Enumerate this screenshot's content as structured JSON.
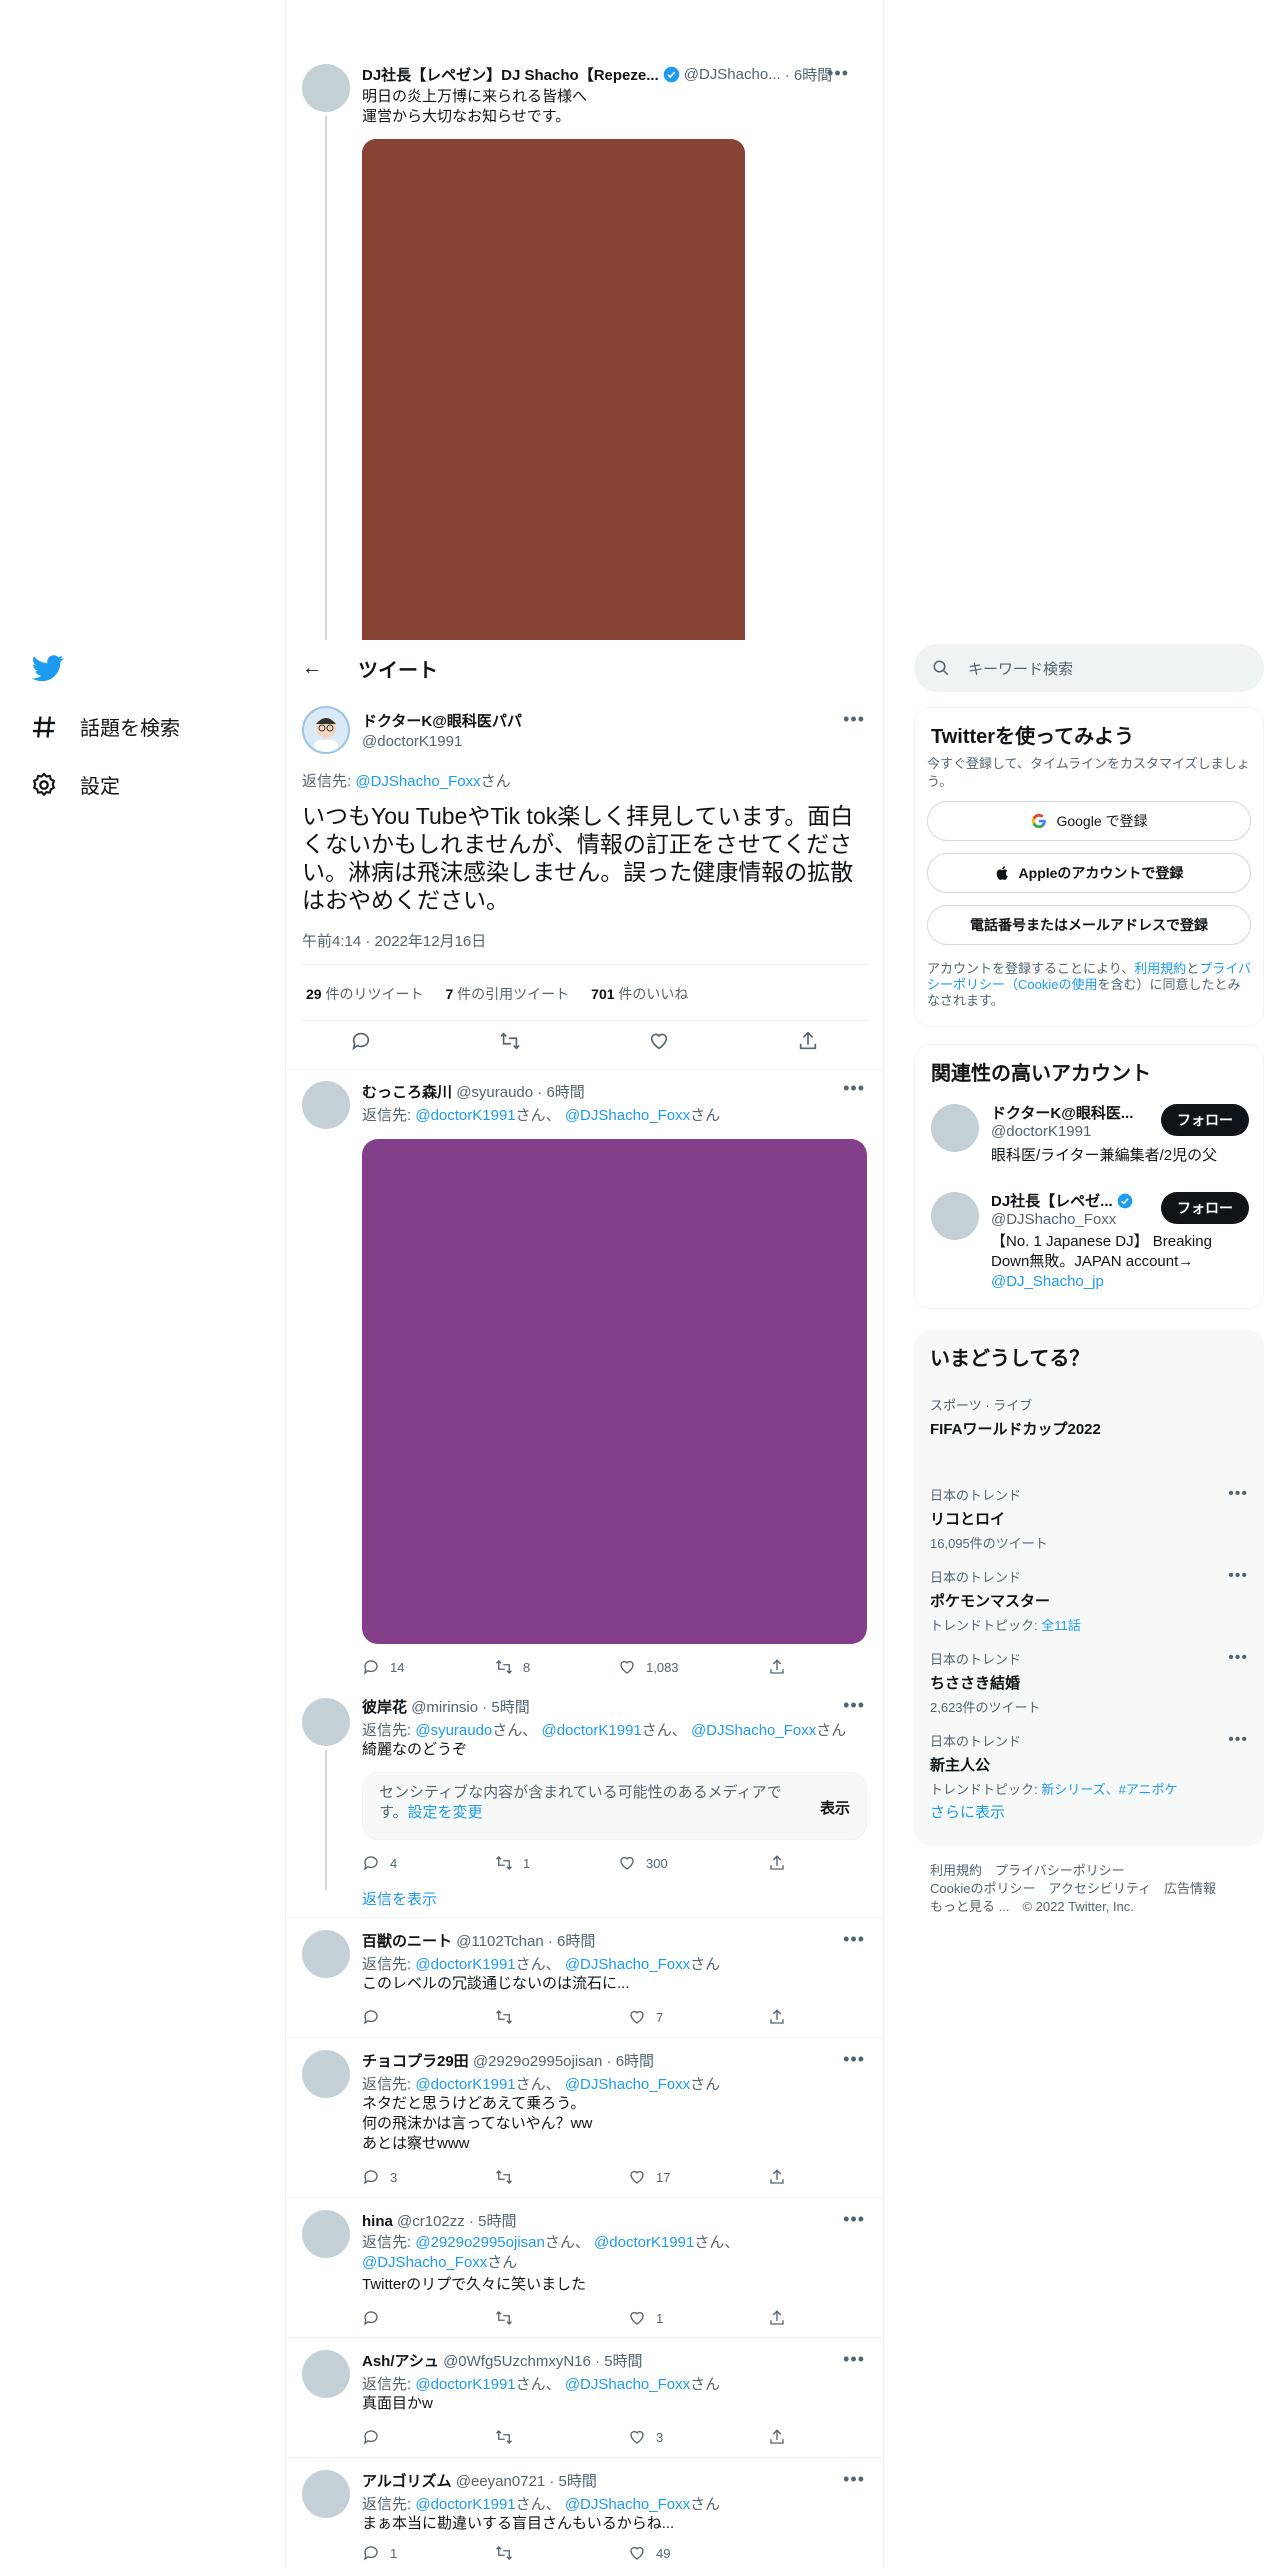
{
  "nav": {
    "explore": "話題を検索",
    "settings": "設定"
  },
  "header": {
    "title": "ツイート",
    "back": "←"
  },
  "parent_tweet": {
    "name": "DJ社長【レペゼン】DJ Shacho【Repeze...",
    "handle": "@DJShacho...",
    "time": "· 6時間",
    "text1": "明日の炎上万博に来られる皆様へ",
    "text2": "運営から大切なお知らせです。",
    "media_color": "#874435"
  },
  "main_tweet": {
    "name": "ドクターK@眼科医パパ",
    "handle": "@doctorK1991",
    "reply_prefix": "返信先:",
    "reply_to": "@DJShacho_Foxx",
    "reply_suffix": "さん",
    "text": "いつもYou TubeやTik tok楽しく拝見しています。面白くないかもしれませんが、情報の訂正をさせてください。淋病は飛沫感染しません。誤った健康情報の拡散はおやめください。",
    "meta": "午前4:14 · 2022年12月16日",
    "rt_count": "29",
    "rt_label": "件のリツイート",
    "qt_count": "7",
    "qt_label": "件の引用ツイート",
    "like_count": "701",
    "like_label": "件のいいね"
  },
  "replies": [
    {
      "name": "むっころ森川",
      "handle": "@syuraudo",
      "time": "· 6時間",
      "reply_prefix": "返信先:",
      "to1": "@doctorK1991",
      "mid": "さん、",
      "to2": "@DJShacho_Foxx",
      "suffix": "さん",
      "text": "",
      "media_color": "#843f8b",
      "reply": "14",
      "rt": "8",
      "like": "1,083"
    },
    {
      "name": "彼岸花",
      "handle": "@mirinsio",
      "time": "· 5時間",
      "reply_prefix": "返信先:",
      "to1": "@syuraudo",
      "mid1": "さん、",
      "to2": "@doctorK1991",
      "mid2": "さん、",
      "to3": "@DJShacho_Foxx",
      "suffix": "さん",
      "text": "綺麗なのどうぞ",
      "sensitive": "センシティブな内容が含まれている可能性のあるメディアです。",
      "settings_link": "設定を変更",
      "show": "表示",
      "reply": "4",
      "rt": "1",
      "like": "300",
      "show_replies": "返信を表示"
    },
    {
      "name": "百獣のニート",
      "handle": "@1102Tchan",
      "time": "· 6時間",
      "reply_prefix": "返信先:",
      "to1": "@doctorK1991",
      "mid": "さん、",
      "to2": "@DJShacho_Foxx",
      "suffix": "さん",
      "text": "このレベルの冗談通じないのは流石に...",
      "reply": "",
      "rt": "",
      "like": "7"
    },
    {
      "name": "チョコプラ29田",
      "handle": "@2929o2995ojisan",
      "time": "· 6時間",
      "reply_prefix": "返信先:",
      "to1": "@doctorK1991",
      "mid": "さん、",
      "to2": "@DJShacho_Foxx",
      "suffix": "さん",
      "text1": "ネタだと思うけどあえて乗ろう。",
      "text2": "何の飛沫かは言ってないやん？ww",
      "text3": "あとは察せwww",
      "reply": "3",
      "rt": "",
      "like": "17"
    },
    {
      "name": "hina",
      "handle": "@cr102zz",
      "time": "· 5時間",
      "reply_prefix": "返信先:",
      "to1": "@2929o2995ojisan",
      "mid1": "さん、",
      "to2": "@doctorK1991",
      "mid2": "さん、",
      "to3": "@DJShacho_Foxx",
      "suffix": "さん",
      "text": "Twitterのリプで久々に笑いました",
      "reply": "",
      "rt": "",
      "like": "1"
    },
    {
      "name": "Ash/アシュ",
      "handle": "@0Wfg5UzchmxyN16",
      "time": "· 5時間",
      "reply_prefix": "返信先:",
      "to1": "@doctorK1991",
      "mid": "さん、",
      "to2": "@DJShacho_Foxx",
      "suffix": "さん",
      "text": "真面目かw",
      "reply": "",
      "rt": "",
      "like": "3"
    },
    {
      "name": "アルゴリズム",
      "handle": "@eeyan0721",
      "time": "· 5時間",
      "reply_prefix": "返信先:",
      "to1": "@doctorK1991",
      "mid": "さん、",
      "to2": "@DJShacho_Foxx",
      "suffix": "さん",
      "text": "まぁ本当に勘違いする盲目さんもいるからね...",
      "reply": "1",
      "rt": "",
      "like": "49"
    }
  ],
  "search": {
    "placeholder": "キーワード検索"
  },
  "signup": {
    "title": "Twitterを使ってみよう",
    "subtitle": "今すぐ登録して、タイムラインをカスタマイズしましょう。",
    "google": "Google で登録",
    "apple": "Appleのアカウントで登録",
    "email": "電話番号またはメールアドレスで登録",
    "legal_pre": "アカウントを登録することにより、",
    "terms": "利用規約",
    "and": "と",
    "privacy": "プライバシーポリシー（Cookieの使用",
    "legal_post": "を含む）に同意したとみなされます。"
  },
  "related": {
    "title": "関連性の高いアカウント",
    "accounts": [
      {
        "name": "ドクターK@眼科医...",
        "handle": "@doctorK1991",
        "bio": "眼科医/ライター兼編集者/2児の父",
        "follow": "フォロー"
      },
      {
        "name": "DJ社長【レペゼ...",
        "handle": "@DJShacho_Foxx",
        "bio": "【No. 1 Japanese DJ】 Breaking Down無敗。JAPAN account→",
        "link": "@DJ_Shacho_jp",
        "follow": "フォロー"
      }
    ]
  },
  "trends": {
    "title": "いまどうしてる？",
    "items": [
      {
        "category": "スポーツ · ライブ",
        "topic": "FIFAワールドカップ2022",
        "count": ""
      },
      {
        "category": "日本のトレンド",
        "topic": "リコとロイ",
        "count": "16,095件のツイート"
      },
      {
        "category": "日本のトレンド",
        "topic": "ポケモンマスター",
        "count": "トレンドトピック: ",
        "link": "全11話"
      },
      {
        "category": "日本のトレンド",
        "topic": "ちささき結婚",
        "count": "2,623件のツイート"
      },
      {
        "category": "日本のトレンド",
        "topic": "新主人公",
        "count": "トレンドトピック: ",
        "link": "新シリーズ、#アニポケ"
      }
    ],
    "more": "さらに表示"
  },
  "footer": {
    "l1": "利用規約　プライバシーポリシー",
    "l2": "Cookieのポリシー　アクセシビリティ　広告情報",
    "l3": "もっと見る ...　© 2022 Twitter, Inc."
  }
}
